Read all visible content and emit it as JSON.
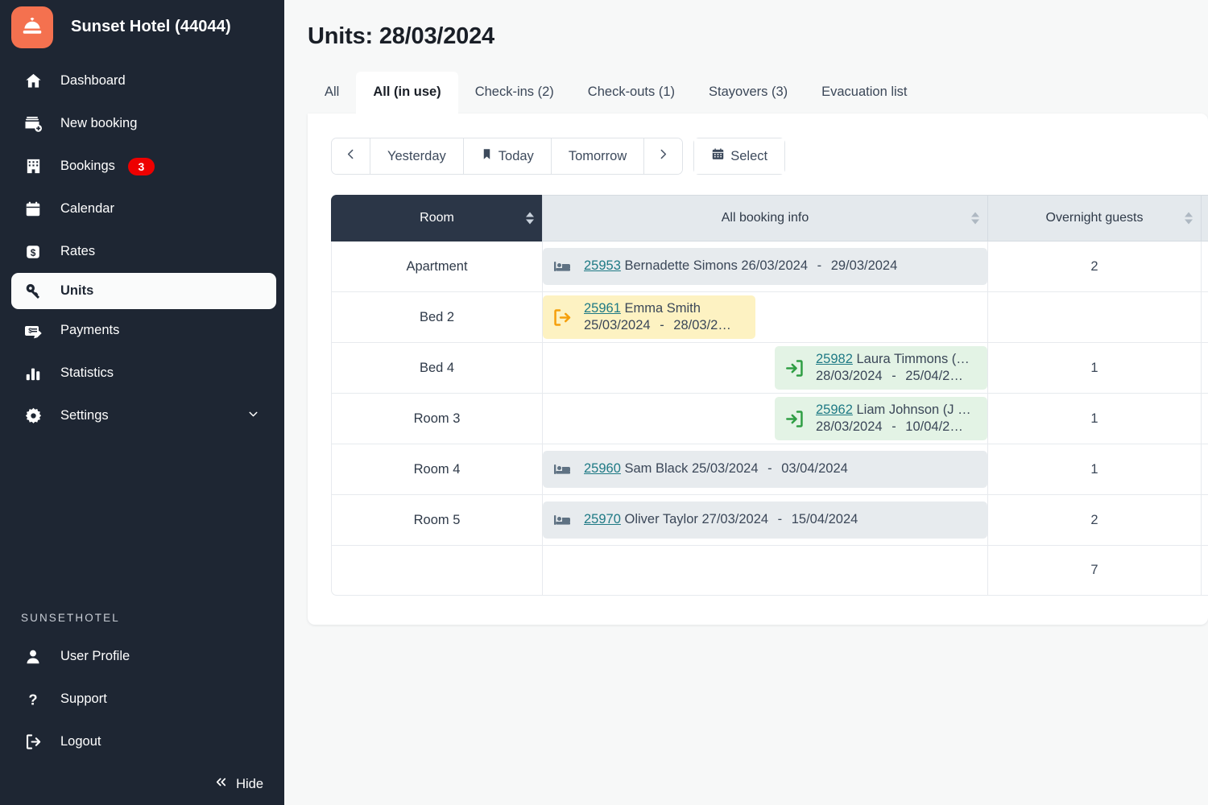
{
  "sidebar": {
    "brand": {
      "logo_icon": "concierge-bell-icon",
      "name": "Sunset Hotel (44044)",
      "accent": "#f4714f"
    },
    "items": [
      {
        "icon": "home-icon",
        "label": "Dashboard"
      },
      {
        "icon": "new-booking-icon",
        "label": "New booking"
      },
      {
        "icon": "building-icon",
        "label": "Bookings",
        "badge": "3"
      },
      {
        "icon": "calendar-icon",
        "label": "Calendar"
      },
      {
        "icon": "dollar-icon",
        "label": "Rates"
      },
      {
        "icon": "key-icon",
        "label": "Units",
        "active": true
      },
      {
        "icon": "payments-icon",
        "label": "Payments"
      },
      {
        "icon": "bar-chart-icon",
        "label": "Statistics"
      },
      {
        "icon": "gear-icon",
        "label": "Settings",
        "chevron": "chevron-down-icon"
      }
    ],
    "footer": {
      "heading": "SUNSETHOTEL",
      "items": [
        {
          "icon": "user-icon",
          "label": "User Profile"
        },
        {
          "icon": "help-icon",
          "label": "Support"
        },
        {
          "icon": "logout-icon",
          "label": "Logout"
        }
      ],
      "hide_label": "Hide",
      "hide_icon": "chevrons-left-icon"
    }
  },
  "main": {
    "page_title": "Units: 28/03/2024",
    "tabs": [
      {
        "label": "All",
        "active": false
      },
      {
        "label": "All (in use)",
        "active": true
      },
      {
        "label": "Check-ins (2)",
        "active": false
      },
      {
        "label": "Check-outs (1)",
        "active": false
      },
      {
        "label": "Stayovers (3)",
        "active": false
      },
      {
        "label": "Evacuation list",
        "active": false
      }
    ],
    "toolbar": {
      "prev_icon": "chevron-left-icon",
      "yesterday_label": "Yesterday",
      "today_label": "Today",
      "today_icon": "bookmark-icon",
      "tomorrow_label": "Tomorrow",
      "next_icon": "chevron-right-icon",
      "select_label": "Select",
      "select_icon": "calendar-icon"
    },
    "table": {
      "columns": [
        {
          "key": "room",
          "label": "Room",
          "sorted": true
        },
        {
          "key": "info",
          "label": "All booking info",
          "sorted": false
        },
        {
          "key": "guests",
          "label": "Overnight guests",
          "sorted": false
        }
      ],
      "rows": [
        {
          "room": "Apartment",
          "guests": "2",
          "booking": {
            "type": "stayover",
            "icon": "bed-icon",
            "id": "25953",
            "guest_name": "Bernadette Simons",
            "date_from": "26/03/2024",
            "date_to": "29/03/2024"
          }
        },
        {
          "room": "Bed 2",
          "guests": "",
          "booking": {
            "type": "checkout",
            "icon": "check-out-icon",
            "id": "25961",
            "guest_name": "Emma Smith",
            "date_from": "25/03/2024",
            "date_to": "28/03/2…"
          }
        },
        {
          "room": "Bed 4",
          "guests": "1",
          "booking": {
            "type": "checkin",
            "icon": "check-in-icon",
            "id": "25982",
            "guest_name": "Laura Timmons (…",
            "date_from": "28/03/2024",
            "date_to": "25/04/2…"
          }
        },
        {
          "room": "Room 3",
          "guests": "1",
          "booking": {
            "type": "checkin",
            "icon": "check-in-icon",
            "id": "25962",
            "guest_name": "Liam Johnson (J …",
            "date_from": "28/03/2024",
            "date_to": "10/04/2…"
          }
        },
        {
          "room": "Room 4",
          "guests": "1",
          "booking": {
            "type": "stayover",
            "icon": "bed-icon",
            "id": "25960",
            "guest_name": "Sam Black",
            "date_from": "25/03/2024",
            "date_to": "03/04/2024"
          }
        },
        {
          "room": "Room 5",
          "guests": "2",
          "booking": {
            "type": "stayover",
            "icon": "bed-icon",
            "id": "25970",
            "guest_name": "Oliver Taylor",
            "date_from": "27/03/2024",
            "date_to": "15/04/2024"
          }
        },
        {
          "room": "",
          "guests": "7",
          "booking": null
        }
      ]
    }
  },
  "colors": {
    "sidebar_bg": "#1e2633",
    "brand_accent": "#f4714f",
    "badge_red": "#ee0000",
    "link_teal": "#1f7a85",
    "stayover_bg": "#e7ebee",
    "checkout_bg": "#fdf2c2",
    "checkin_bg": "#e3f3e5",
    "checkin_icon": "#2f9e44",
    "checkout_icon": "#f59f0b",
    "header_dark": "#2b3647",
    "header_light": "#e4e9ed"
  }
}
